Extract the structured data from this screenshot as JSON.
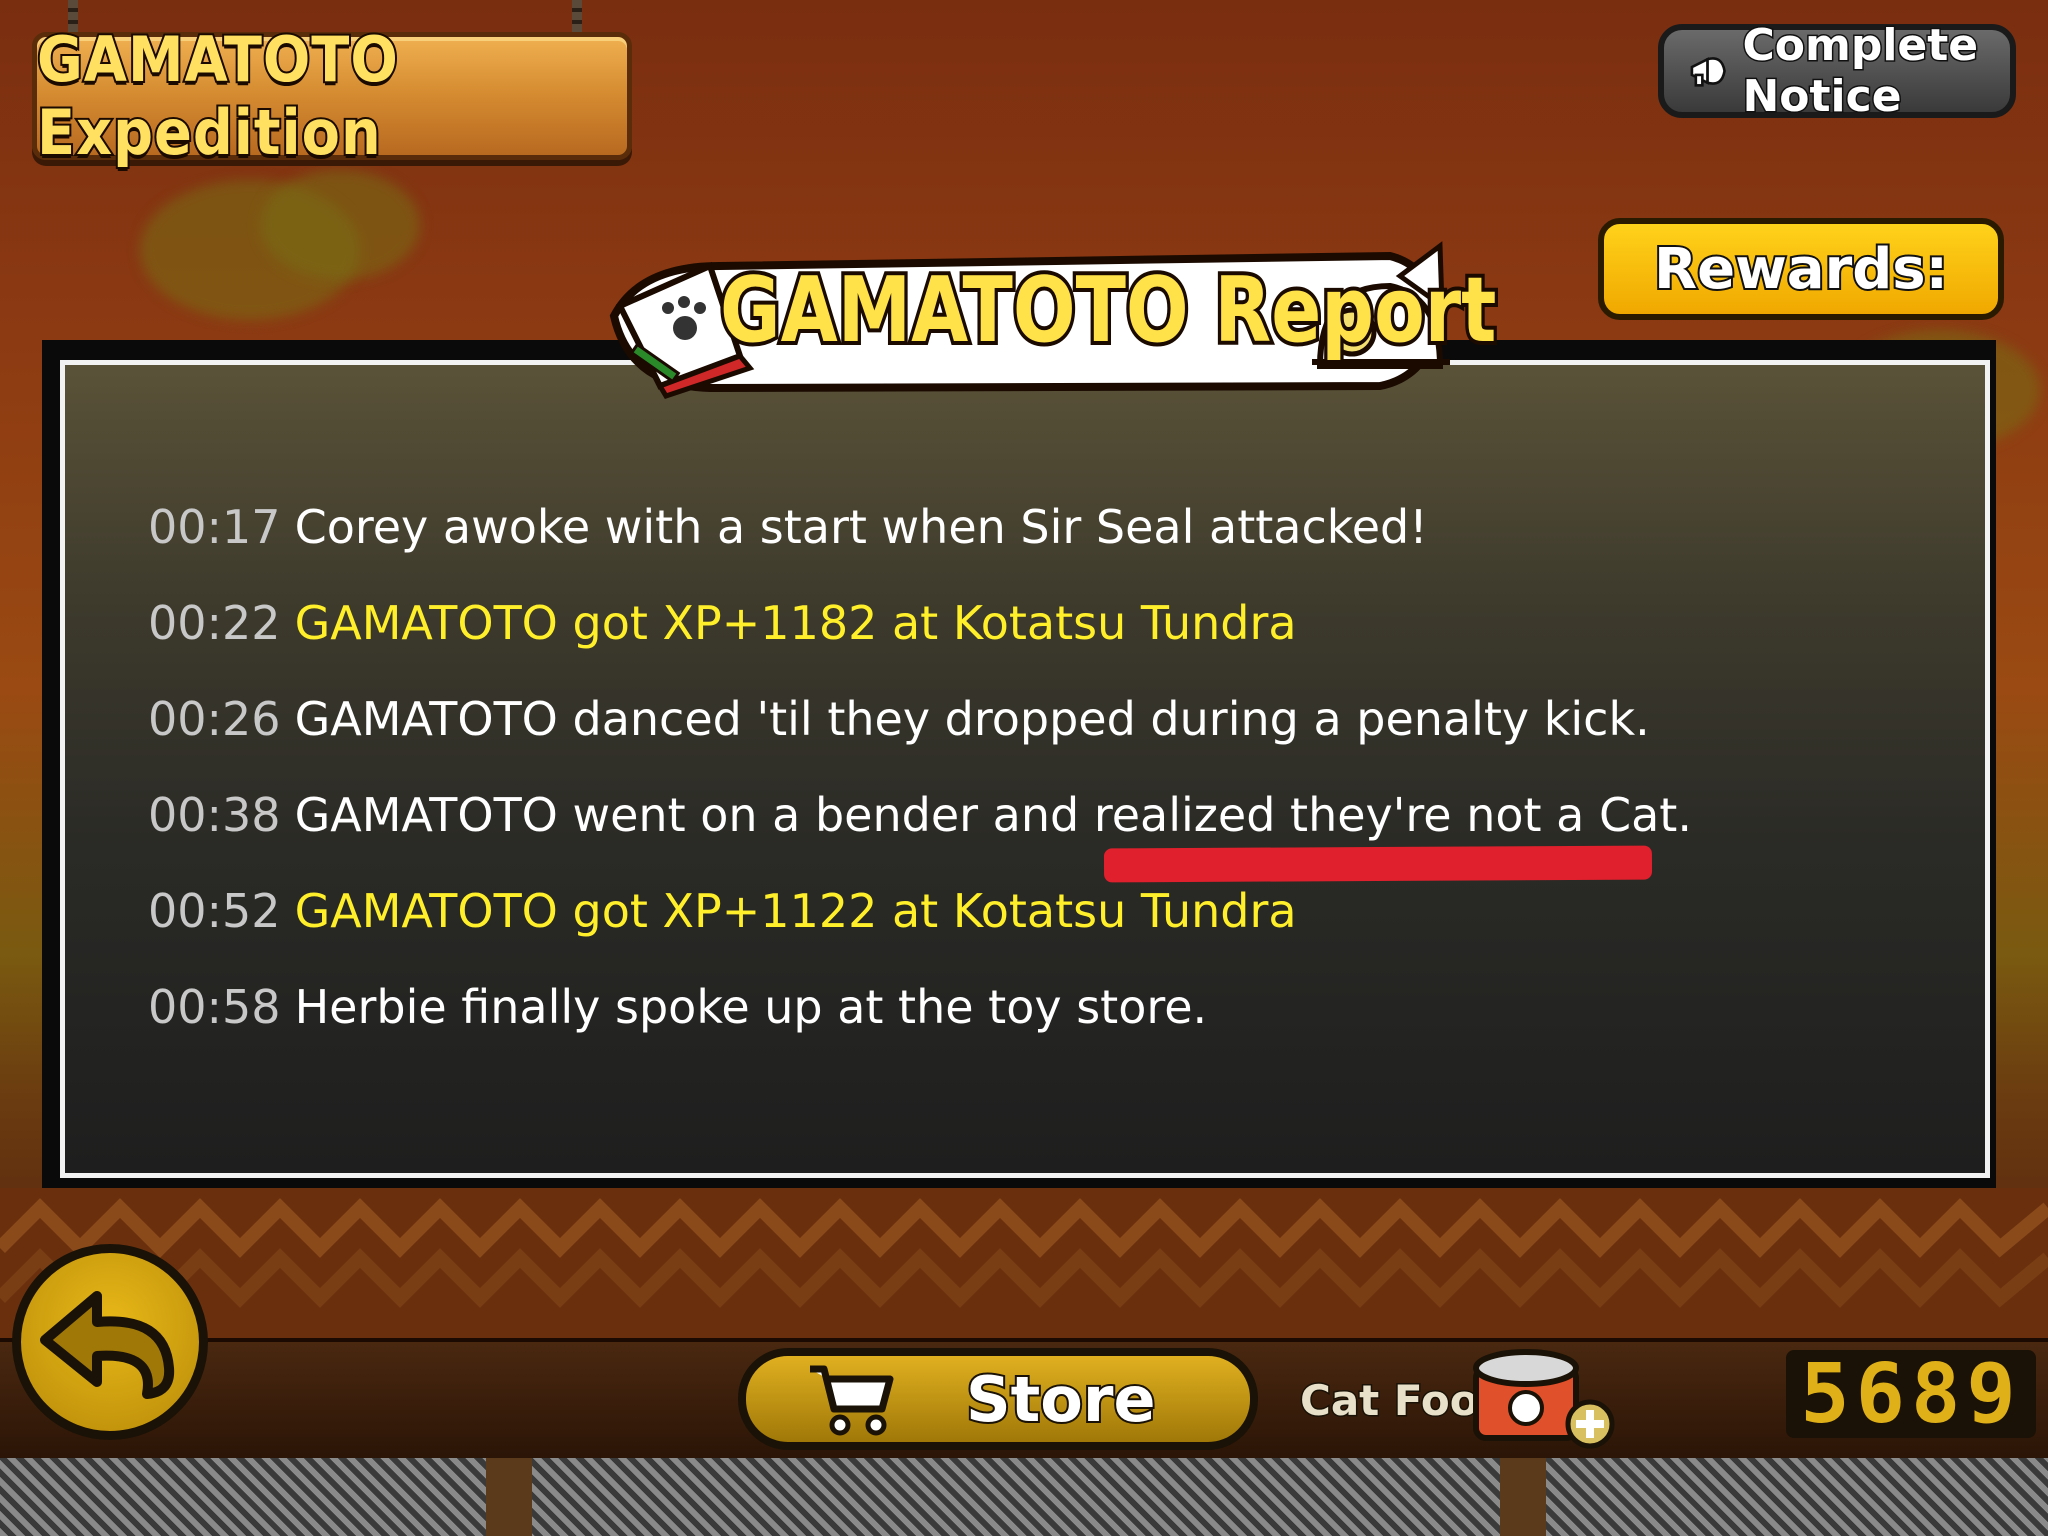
{
  "header": {
    "expedition_title": "GAMATOTO Expedition",
    "complete_notice_label": "Complete Notice",
    "rewards_label": "Rewards:"
  },
  "report": {
    "title": "GAMATOTO Report",
    "entries": [
      {
        "time": "00:17",
        "text": "Corey awoke with a start when Sir Seal attacked!",
        "type": "event"
      },
      {
        "time": "00:22",
        "text": "GAMATOTO got XP+1182 at Kotatsu Tundra",
        "type": "xp"
      },
      {
        "time": "00:26",
        "text": "GAMATOTO danced 'til they dropped during a penalty kick.",
        "type": "event"
      },
      {
        "time": "00:38",
        "text": "GAMATOTO went on a bender and realized they're not a Cat.",
        "type": "event"
      },
      {
        "time": "00:52",
        "text": "GAMATOTO got XP+1122 at Kotatsu Tundra",
        "type": "xp"
      },
      {
        "time": "00:58",
        "text": "Herbie finally spoke up at the toy store.",
        "type": "event"
      }
    ]
  },
  "footer": {
    "store_label": "Store",
    "cat_food_label": "Cat Food",
    "cat_food_count": "5689"
  },
  "colors": {
    "xp_text": "#ffef2a",
    "event_text": "#ffffff",
    "time_text": "#c8c8c8",
    "accent_yellow": "#ffd21a",
    "annotation_red": "#e0202c"
  },
  "icons": {
    "notice": "megaphone-icon",
    "back": "back-arrow-icon",
    "store": "cart-icon",
    "cat_food": "cat-food-can-icon",
    "add": "plus-icon"
  }
}
